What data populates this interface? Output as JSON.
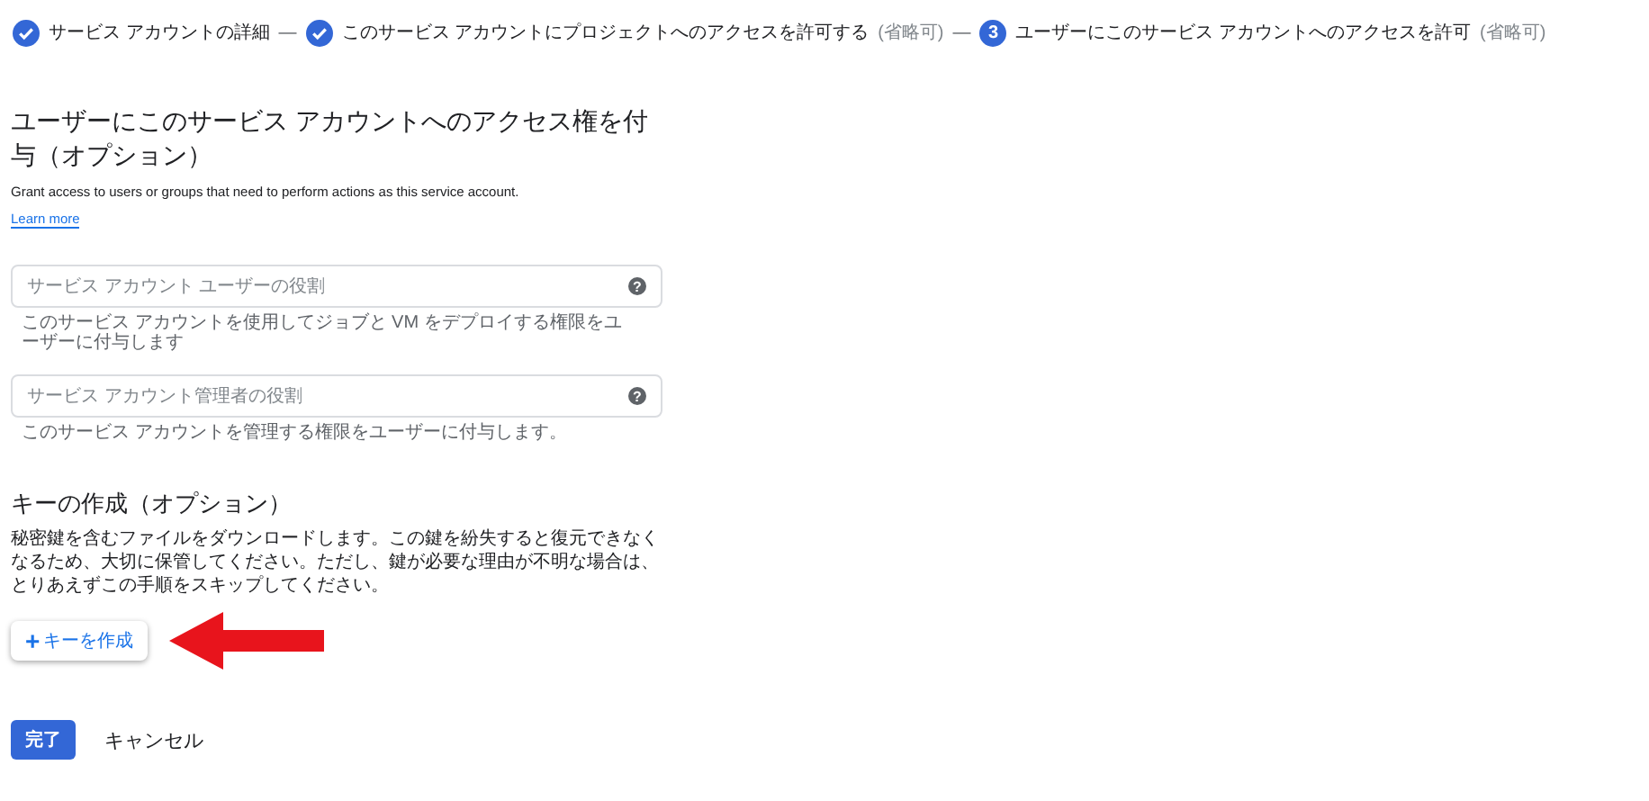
{
  "steps": [
    {
      "completed": true,
      "label": "サービス アカウントの詳細"
    },
    {
      "completed": true,
      "label": "このサービス アカウントにプロジェクトへのアクセスを許可する",
      "optional": "(省略可)"
    },
    {
      "completed": false,
      "number": "3",
      "label": "ユーザーにこのサービス アカウントへのアクセスを許可",
      "optional": "(省略可)"
    }
  ],
  "step_separator": "—",
  "access_section": {
    "title": "ユーザーにこのサービス アカウントへのアクセス権を付与（オプション）",
    "description": "Grant access to users or groups that need to perform actions as this service account.",
    "link": "Learn more",
    "fields": [
      {
        "placeholder": "サービス アカウント ユーザーの役割",
        "help_icon": "?",
        "hint": "このサービス アカウントを使用してジョブと VM をデプロイする権限をユーザーに付与します"
      },
      {
        "placeholder": "サービス アカウント管理者の役割",
        "help_icon": "?",
        "hint": "このサービス アカウントを管理する権限をユーザーに付与します。"
      }
    ]
  },
  "key_section": {
    "title": "キーの作成（オプション）",
    "description": "秘密鍵を含むファイルをダウンロードします。この鍵を紛失すると復元できなくなるため、大切に保管してください。ただし、鍵が必要な理由が不明な場合は、とりあえずこの手順をスキップしてください。",
    "button": {
      "icon": "+",
      "label": "キーを作成"
    }
  },
  "actions": {
    "done": "完了",
    "cancel": "キャンセル"
  }
}
